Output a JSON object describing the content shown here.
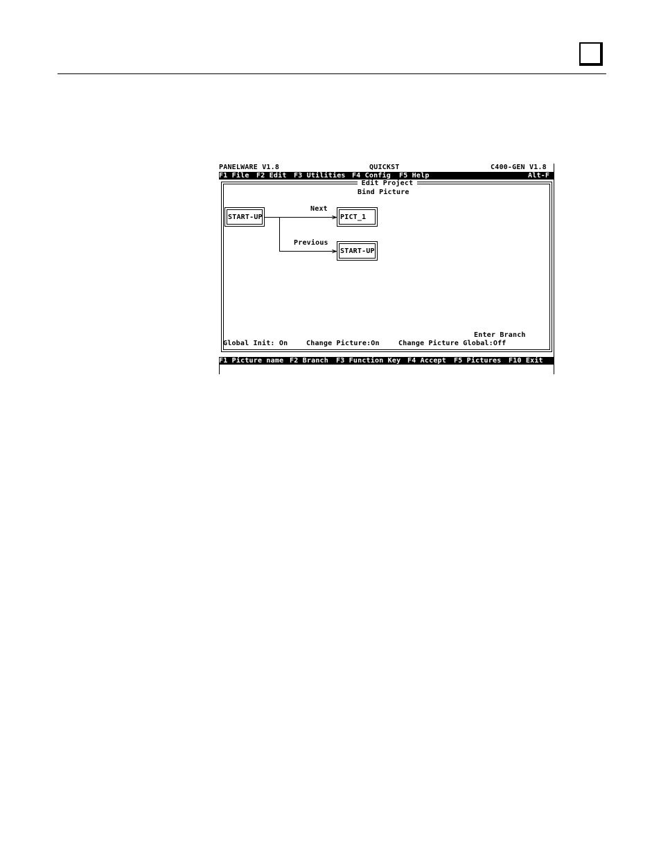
{
  "title_bar": {
    "app": "PANELWARE V1.8",
    "project": "QUICKST",
    "target": "C400-GEN V1.8"
  },
  "menu_bar": {
    "items": [
      "F1 File",
      "F2 Edit",
      "F3 Utilities",
      "F4 Config",
      "F5 Help"
    ],
    "shortcut": "Alt-F"
  },
  "panel": {
    "title": "Edit Project",
    "subtitle": "Bind Picture"
  },
  "diagram": {
    "source": "START-UP",
    "branches": [
      {
        "label": "Next",
        "target": "PICT_1"
      },
      {
        "label": "Previous",
        "target": "START-UP"
      }
    ]
  },
  "prompt": "Enter Branch",
  "status": {
    "global_init": "Global Init: On",
    "change_picture": "Change Picture:On",
    "change_picture_global": "Change Picture Global:Off"
  },
  "function_bar": [
    "F1 Picture name",
    "F2 Branch",
    "F3 Function Key",
    "F4 Accept",
    "F5 Pictures",
    "F10 Exit"
  ]
}
